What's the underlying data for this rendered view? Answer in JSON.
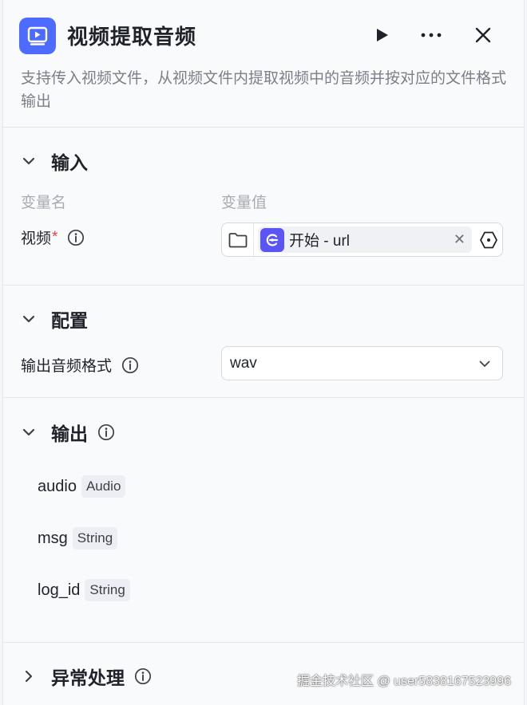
{
  "header": {
    "title": "视频提取音频",
    "description": "支持传入视频文件，从视频文件内提取视频中的音频并按对应的文件格式输出",
    "accent_color": "#4d6bfe"
  },
  "input_section": {
    "title": "输入",
    "col_name": "变量名",
    "col_value": "变量值",
    "field_label": "视频",
    "required_mark": "*",
    "variable_chip": "开始 - url",
    "chip_color": "#5b55f5"
  },
  "config_section": {
    "title": "配置",
    "field_label": "输出音频格式",
    "selected_value": "wav"
  },
  "output_section": {
    "title": "输出",
    "items": [
      {
        "name": "audio",
        "type": "Audio"
      },
      {
        "name": "msg",
        "type": "String"
      },
      {
        "name": "log_id",
        "type": "String"
      }
    ]
  },
  "exception_section": {
    "title": "异常处理"
  },
  "watermark": "掘金技术社区 @ user5838167523996"
}
